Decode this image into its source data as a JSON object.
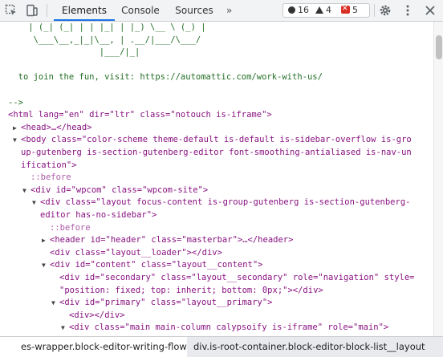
{
  "toolbar": {
    "tabs": [
      {
        "label": "Elements",
        "active": true
      },
      {
        "label": "Console",
        "active": false
      },
      {
        "label": "Sources",
        "active": false
      }
    ],
    "more_label": "»",
    "counts": {
      "info": "16",
      "warnings": "4",
      "errors": "5"
    },
    "icons": [
      "inspect-icon",
      "device-toggle-icon",
      "more-tabs-icon",
      "settings-gear-icon",
      "kebab-menu-icon"
    ]
  },
  "code_lines": [
    "    | (_| (_| | | |_| | |_) \\__ \\ (_) |",
    "     \\___\\__,_|_|\\__, | .__/|___/\\___/",
    "                  |___/|_|",
    "",
    "  to join the fun, visit: https://automattic.com/work-with-us/",
    "",
    "-->",
    "<html lang=\"en\" dir=\"ltr\" class=\"notouch is-iframe\">",
    "<head>…</head>",
    "<body class=\"color-scheme theme-default is-default is-sidebar-overflow is-gro",
    "up-gutenberg is-section-gutenberg-editor font-smoothing-antialiased is-nav-un",
    "ification\">",
    "::before",
    "<div id=\"wpcom\" class=\"wpcom-site\">",
    "<div class=\"layout focus-content is-group-gutenberg is-section-gutenberg-",
    "editor has-no-sidebar\">",
    "::before",
    "<header id=\"header\" class=\"masterbar\">…</header>",
    "<div class=\"layout__loader\"></div>",
    "<div id=\"content\" class=\"layout__content\">",
    "<div id=\"secondary\" class=\"layout__secondary\" role=\"navigation\" style=",
    "\"position: fixed; top: inherit; bottom: 0px;\"></div>",
    "<div id=\"primary\" class=\"layout__primary\">",
    "<div></div>",
    "<div class=\"main main-column calypsoify is-iframe\" role=\"main\">"
  ],
  "breadcrumbs": [
    {
      "label": "es-wrapper.block-editor-writing-flow",
      "selected": false
    },
    {
      "label": "div.is-root-container.block-editor-block-list__layout",
      "selected": true
    }
  ],
  "colors": {
    "tag": "#881280",
    "attr_name": "#994500",
    "attr_value": "#1a1aa6",
    "comment": "#236e25",
    "accent": "#1a73e8",
    "error": "#d93025"
  }
}
